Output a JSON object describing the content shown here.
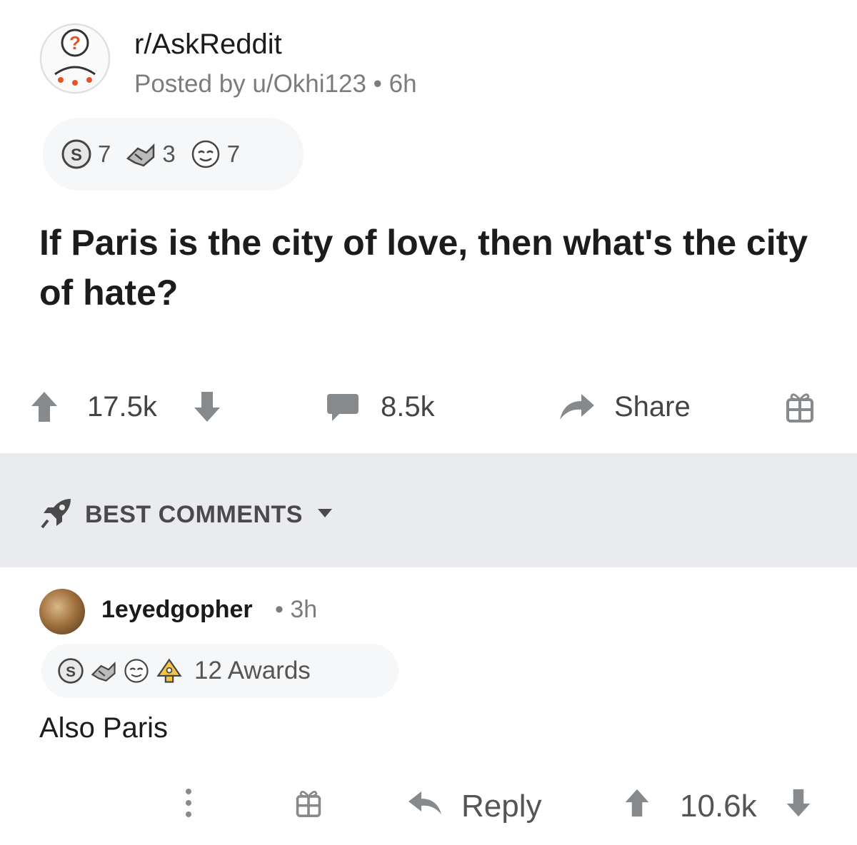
{
  "post": {
    "subreddit": "r/AskReddit",
    "meta": "Posted by u/Okhi123 • 6h",
    "awards": [
      {
        "icon": "silver-award-icon",
        "count": "7"
      },
      {
        "icon": "helpful-award-icon",
        "count": "3"
      },
      {
        "icon": "wholesome-award-icon",
        "count": "7"
      }
    ],
    "title": "If Paris is the city of love, then what's the city of hate?",
    "votes": "17.5k",
    "comments_count": "8.5k",
    "share_label": "Share"
  },
  "sort": {
    "label": "BEST COMMENTS"
  },
  "comment": {
    "author": "1eyedgopher",
    "time": "• 3h",
    "awards_label": "12 Awards",
    "body": "Also Paris",
    "reply_label": "Reply",
    "votes": "10.6k"
  },
  "colors": {
    "icon_gray": "#878a8c",
    "band": "#e9ebee",
    "pill": "#f6f7f8"
  }
}
